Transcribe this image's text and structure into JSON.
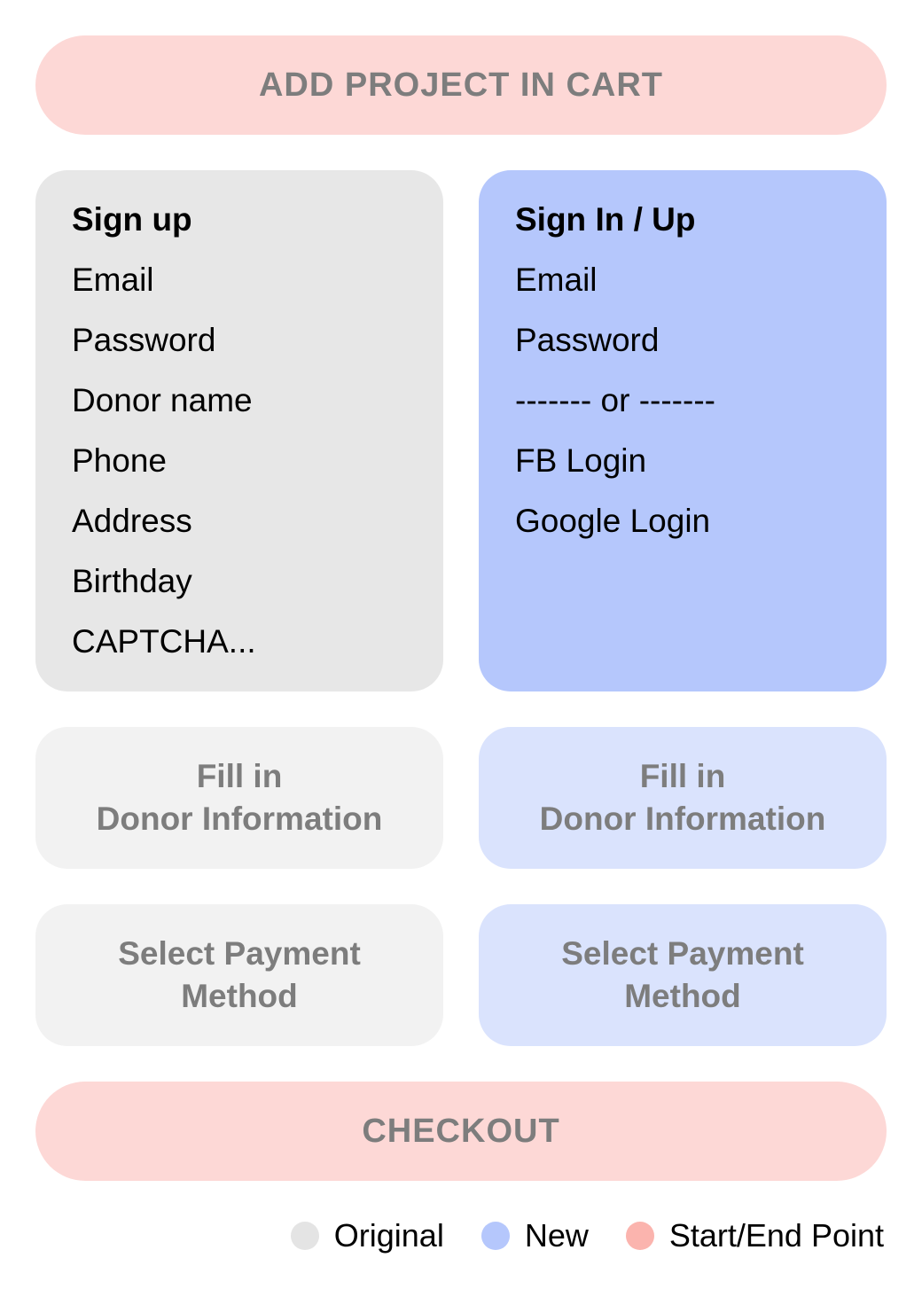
{
  "start": {
    "label": "ADD PROJECT IN CART",
    "color": "#fdd8d6"
  },
  "original_panel": {
    "heading": "Sign up",
    "fields": [
      "Email",
      "Password",
      "Donor name",
      "Phone",
      "Address",
      "Birthday",
      "CAPTCHA..."
    ]
  },
  "new_panel": {
    "heading": "Sign In / Up",
    "fields": [
      "Email",
      "Password",
      "------- or -------",
      "FB Login",
      "Google Login"
    ]
  },
  "steps": {
    "donor_info": {
      "line1": "Fill in",
      "line2": "Donor Information"
    },
    "payment": {
      "line1": "Select Payment",
      "line2": "Method"
    }
  },
  "end": {
    "label": "CHECKOUT"
  },
  "legend": [
    {
      "label": "Original",
      "color": "#e4e4e4"
    },
    {
      "label": "New",
      "color": "#b5c7fc"
    },
    {
      "label": "Start/End Point",
      "color": "#fbb4ae"
    }
  ]
}
